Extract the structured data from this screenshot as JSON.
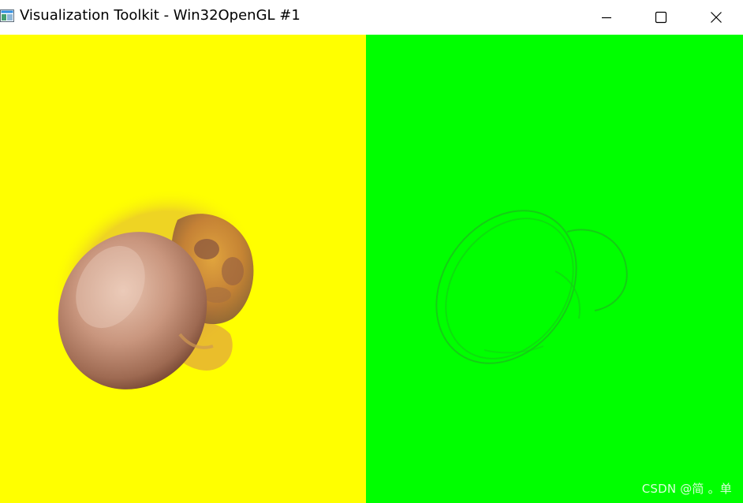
{
  "window": {
    "title": "Visualization Toolkit - Win32OpenGL #1",
    "controls": {
      "minimize_icon": "minimize-icon",
      "maximize_icon": "maximize-icon",
      "close_icon": "close-icon"
    }
  },
  "viewports": {
    "left": {
      "background": "#ffff00",
      "content": "volume-rendered-skull"
    },
    "right": {
      "background": "#00ff00",
      "content": "volume-rendered-skull-outline"
    }
  },
  "watermark": {
    "text": "CSDN @简 。单"
  }
}
